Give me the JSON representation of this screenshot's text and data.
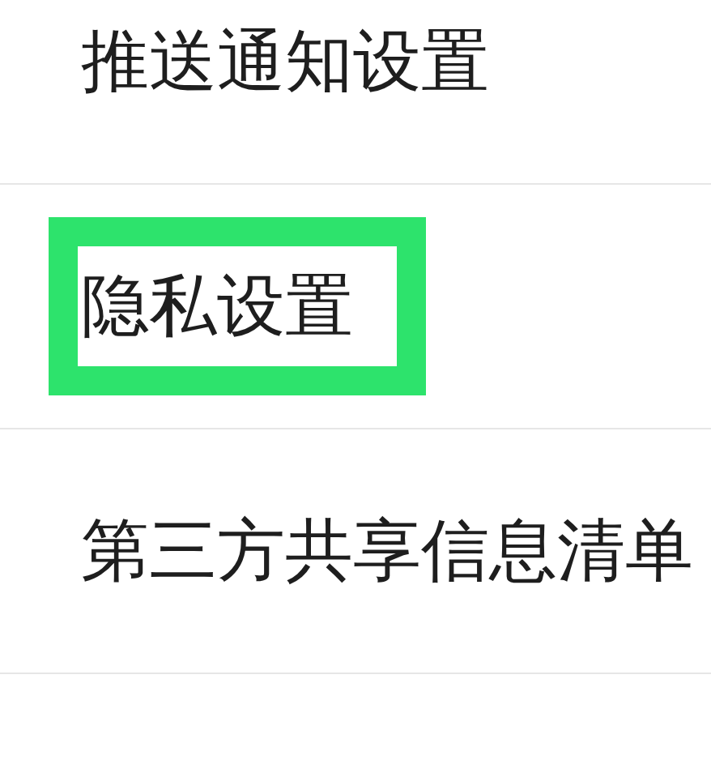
{
  "settings_items": [
    {
      "label": "推送通知设置",
      "highlighted": false
    },
    {
      "label": "隐私设置",
      "highlighted": true
    },
    {
      "label": "第三方共享信息清单",
      "highlighted": false
    }
  ]
}
